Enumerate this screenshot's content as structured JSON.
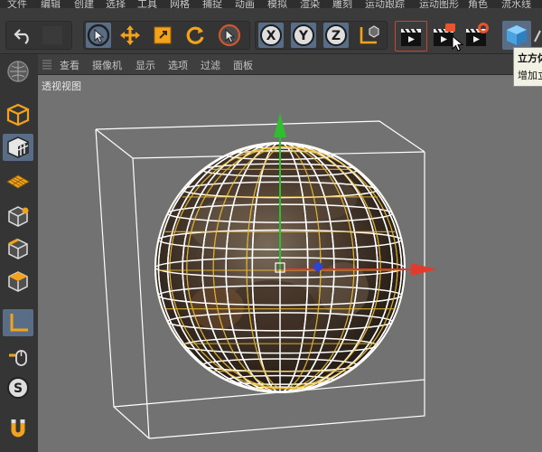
{
  "menu": [
    "文件",
    "编辑",
    "创建",
    "选择",
    "工具",
    "网格",
    "捕捉",
    "动画",
    "模拟",
    "渲染",
    "雕刻",
    "运动跟踪",
    "运动图形",
    "角色",
    "流水线"
  ],
  "toolbar": {
    "undo": "undo-icon",
    "axis_x": "X",
    "axis_y": "Y",
    "axis_z": "Z"
  },
  "viewport_menu": [
    "查看",
    "摄像机",
    "显示",
    "选项",
    "过滤",
    "面板"
  ],
  "viewport_label": "透视视图",
  "tooltip": {
    "title": "立方体",
    "desc": "增加立方体"
  },
  "sidebar_items": [
    "make-editable-icon",
    "model-mode-icon",
    "texture-mode-icon",
    "workplane-icon",
    "points-mode-icon",
    "edges-mode-icon",
    "polygons-mode-icon",
    "axis-mode-icon",
    "tweak-mode-icon",
    "snap-icon",
    "magnet-icon"
  ],
  "colors": {
    "selected": "#596d86",
    "viewport_bg": "#727272",
    "wire_white": "#ffffff",
    "wire_yellow": "#f3c437",
    "axis_x": "#e23b2e",
    "axis_y": "#2fbe2f",
    "axis_z": "#2b45d8"
  }
}
